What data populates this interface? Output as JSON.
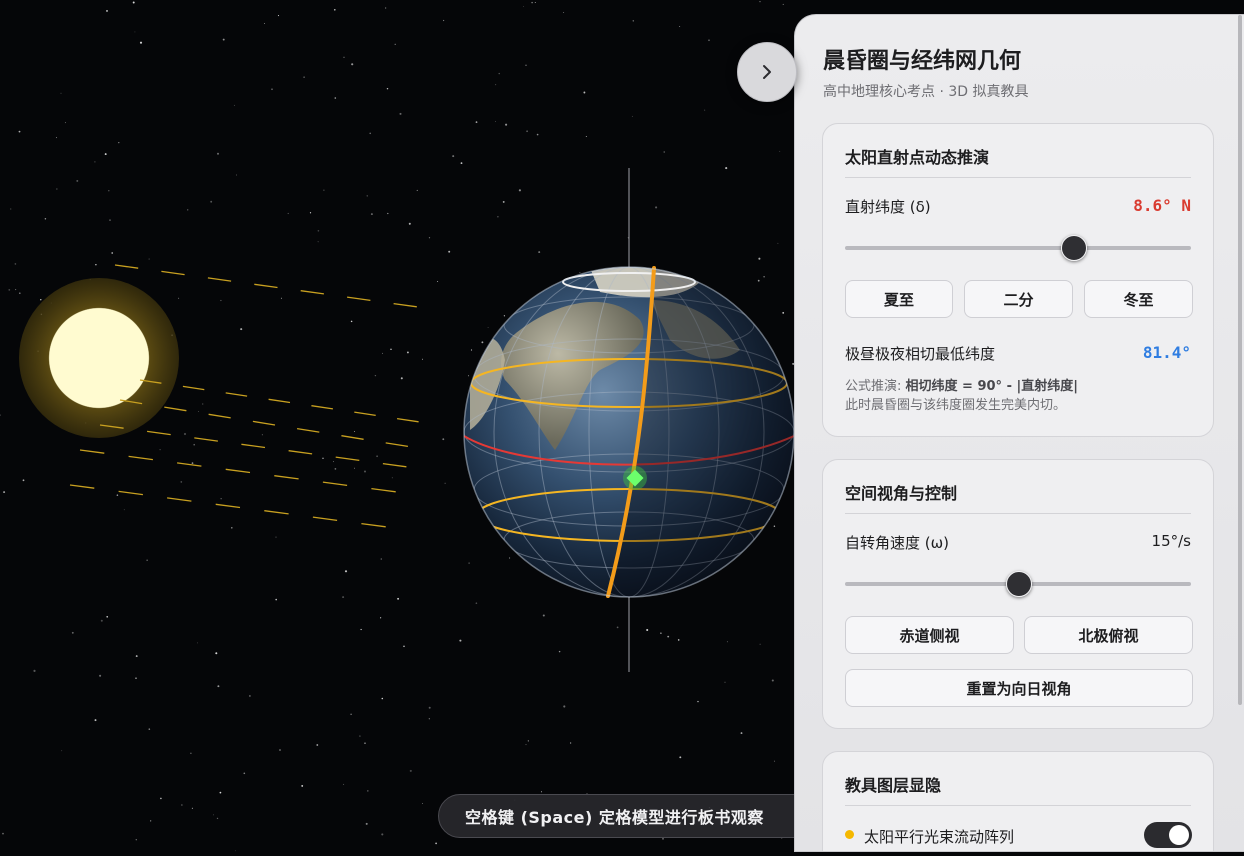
{
  "panel": {
    "title": "晨昏圈与经纬网几何",
    "subtitle": "高中地理核心考点 · 3D 拟真教具"
  },
  "sun_card": {
    "title": "太阳直射点动态推演",
    "declination_label": "直射纬度 (δ)",
    "declination_value": "8.6° N",
    "declination_slider_fraction": 0.66,
    "buttons": [
      "夏至",
      "二分",
      "冬至"
    ],
    "min_lat_label": "极昼极夜相切最低纬度",
    "min_lat_value": "81.4°",
    "formula_prefix": "公式推演: ",
    "formula_bold": "相切纬度 = 90° - |直射纬度|",
    "formula_line2": "此时晨昏圈与该纬度圈发生完美内切。"
  },
  "view_card": {
    "title": "空间视角与控制",
    "speed_label": "自转角速度 (ω)",
    "speed_value": "15°/s",
    "speed_slider_fraction": 0.5,
    "buttons": [
      "赤道侧视",
      "北极俯视"
    ],
    "reset_button": "重置为向日视角"
  },
  "layer_card": {
    "title": "教具图层显隐",
    "items": [
      {
        "label": "太阳平行光束流动阵列",
        "enabled": true
      }
    ]
  },
  "hint": "空格键 (Space) 定格模型进行板书观察",
  "colors": {
    "declination_value": "#d93b30",
    "min_lat_value": "#2f7de1",
    "sun": "#fdf8c4",
    "terminator": "#f39c1a",
    "equator": "#e53935",
    "tropics": "#f5b622"
  },
  "icons": {
    "collapse": "chevron-right-icon",
    "layer_bullet": "dot-icon"
  }
}
